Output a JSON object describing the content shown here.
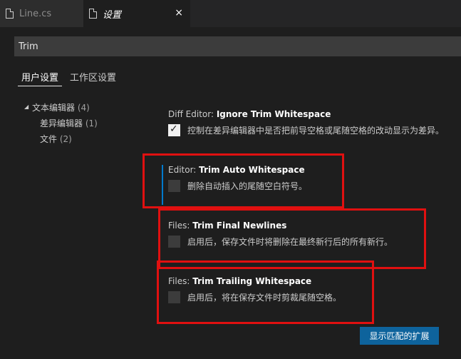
{
  "tabs": [
    {
      "label": "Line.cs",
      "icon": "file-icon",
      "active": false
    },
    {
      "label": "设置",
      "icon": "file-icon",
      "active": true,
      "close": "×"
    }
  ],
  "search": {
    "value": "Trim",
    "placeholder": ""
  },
  "scope_tabs": [
    {
      "label": "用户设置",
      "active": true
    },
    {
      "label": "工作区设置",
      "active": false
    }
  ],
  "tree": [
    {
      "label": "文本编辑器",
      "count": "(4)",
      "expanded": true
    },
    {
      "label": "差异编辑器",
      "count": "(1)"
    },
    {
      "label": "文件",
      "count": "(2)"
    }
  ],
  "settings": [
    {
      "category": "Diff Editor: ",
      "name": "Ignore Trim Whitespace",
      "description": "控制在差异编辑器中是否把前导空格或尾随空格的改动显示为差异。",
      "checked": true
    },
    {
      "category": "Editor: ",
      "name": "Trim Auto Whitespace",
      "description": "删除自动插入的尾随空白符号。",
      "checked": false
    },
    {
      "category": "Files: ",
      "name": "Trim Final Newlines",
      "description": "启用后，保存文件时将删除在最终新行后的所有新行。",
      "checked": false
    },
    {
      "category": "Files: ",
      "name": "Trim Trailing Whitespace",
      "description": "启用后，将在保存文件时剪裁尾随空格。",
      "checked": false
    }
  ],
  "footer": {
    "button_label": "显示匹配的扩展"
  },
  "colors": {
    "accent": "#007acc",
    "button": "#0e639c",
    "highlight": "#e01010",
    "background": "#1e1e1e"
  }
}
